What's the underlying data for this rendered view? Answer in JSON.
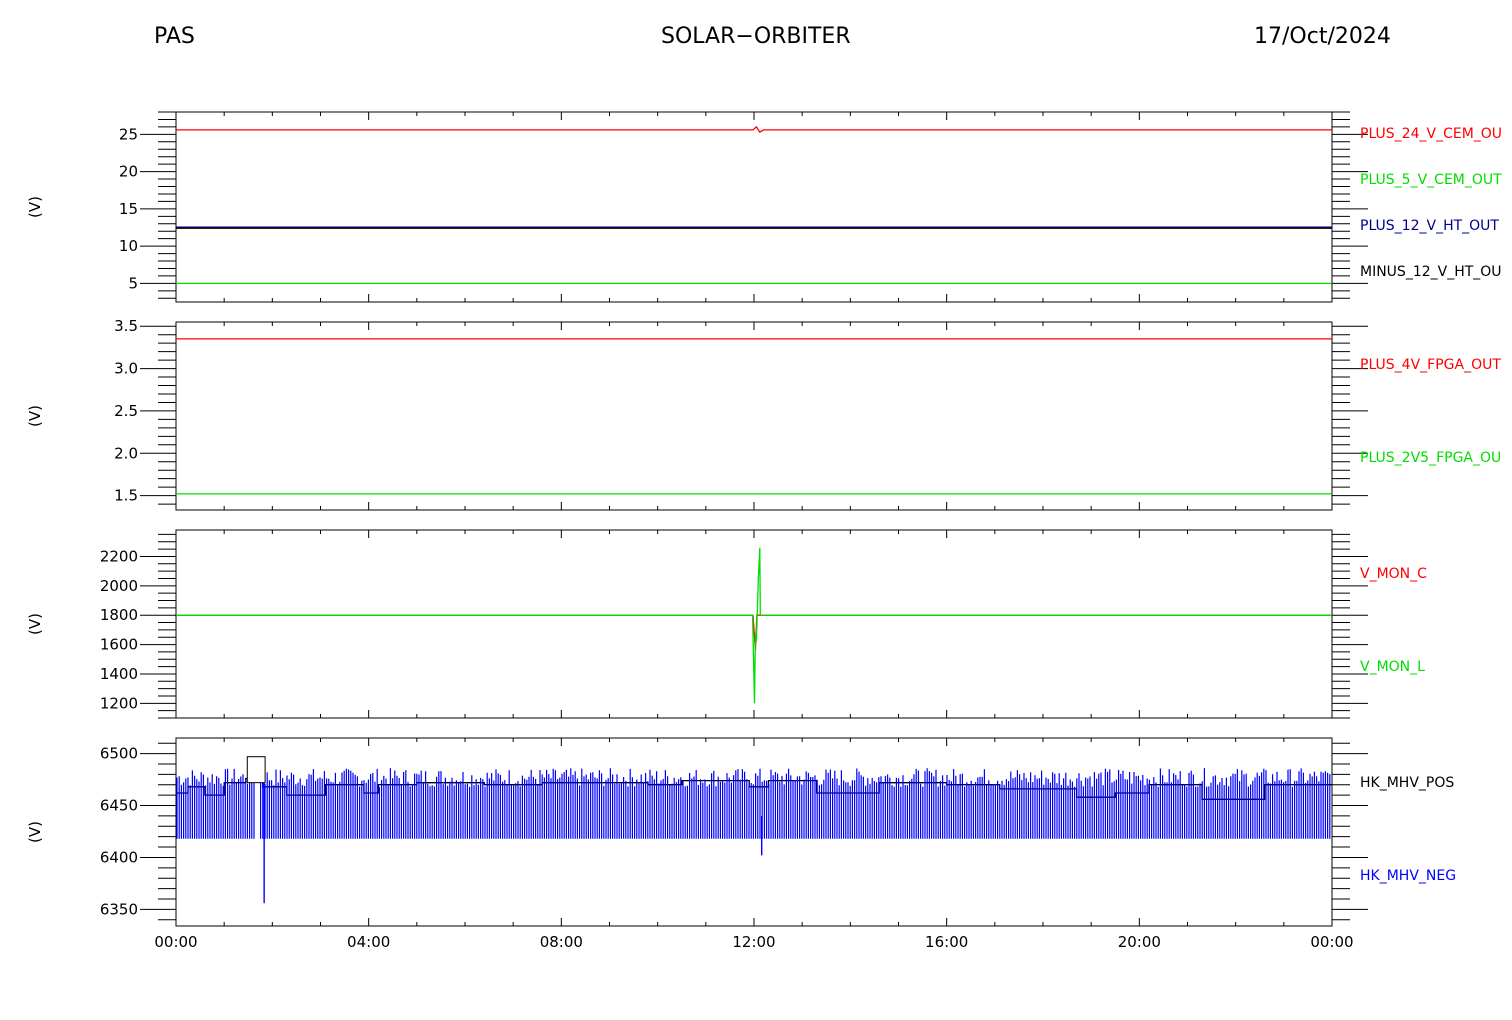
{
  "header": {
    "left": "PAS",
    "center": "SOLAR−ORBITER",
    "right": "17/Oct/2024"
  },
  "x_axis": {
    "ticks": [
      "00:00",
      "04:00",
      "08:00",
      "12:00",
      "16:00",
      "20:00",
      "00:00"
    ],
    "range_hours": [
      0,
      24
    ]
  },
  "chart_data": [
    {
      "type": "line",
      "ylabel": "(V)",
      "ylim": [
        2.5,
        28
      ],
      "yticks": [
        5,
        10,
        15,
        20,
        25
      ],
      "yminor": 1,
      "series": [
        {
          "name": "PLUS_24_V_CEM_OU",
          "color": "#ff0000",
          "x": [
            0,
            11.98,
            12.05,
            12.12,
            12.2,
            24
          ],
          "values": [
            25.6,
            25.6,
            26.0,
            25.3,
            25.6,
            25.6
          ]
        },
        {
          "name": "PLUS_5_V_CEM_OUT",
          "color": "#00dd00",
          "x": [
            0,
            24
          ],
          "values": [
            5.0,
            5.0
          ]
        },
        {
          "name": "PLUS_12_V_HT_OUT",
          "color": "#00008b",
          "x": [
            0,
            24
          ],
          "values": [
            12.5,
            12.5
          ]
        },
        {
          "name": "MINUS_12_V_HT_OU",
          "color": "#000000",
          "x": [
            0,
            24
          ],
          "values": [
            12.4,
            12.4
          ]
        }
      ]
    },
    {
      "type": "line",
      "ylabel": "(V)",
      "ylim": [
        1.33,
        3.55
      ],
      "yticks": [
        1.5,
        2.0,
        2.5,
        3.0,
        3.5
      ],
      "yminor": 0.1,
      "series": [
        {
          "name": "PLUS_4V_FPGA_OUT",
          "color": "#ff0000",
          "x": [
            0,
            24
          ],
          "values": [
            3.35,
            3.35
          ]
        },
        {
          "name": "PLUS_2V5_FPGA_OU",
          "color": "#00dd00",
          "x": [
            0,
            24
          ],
          "values": [
            1.52,
            1.52
          ]
        }
      ]
    },
    {
      "type": "line",
      "ylabel": "(V)",
      "ylim": [
        1100,
        2380
      ],
      "yticks": [
        1200,
        1400,
        1600,
        1800,
        2000,
        2200
      ],
      "yminor": 50,
      "series": [
        {
          "name": "V_MON_C",
          "color": "#ff0000",
          "x": [
            0,
            11.98,
            12.03,
            12.06,
            24
          ],
          "values": [
            1800,
            1800,
            1560,
            1800,
            1800
          ]
        },
        {
          "name": "V_MON_L",
          "color": "#00dd00",
          "x": [
            0,
            11.97,
            12.01,
            12.03,
            12.05,
            12.09,
            12.12,
            12.13,
            12.17,
            24
          ],
          "values": [
            1800,
            1800,
            1200,
            1680,
            1620,
            2040,
            2260,
            1800,
            1800,
            1800
          ]
        }
      ]
    },
    {
      "type": "line",
      "ylabel": "(V)",
      "ylim": [
        6334,
        6515
      ],
      "yticks": [
        6350,
        6400,
        6450,
        6500
      ],
      "yminor": 10,
      "series": [
        {
          "name": "HK_MHV_POS",
          "color": "#000000",
          "x": [
            0,
            0.25,
            0.25,
            0.6,
            0.6,
            1.0,
            1.0,
            1.45,
            1.45,
            1.8,
            1.8,
            2.3,
            2.3,
            3.1,
            3.1,
            3.9,
            3.9,
            4.2,
            4.2,
            5.0,
            5.0,
            6.4,
            6.4,
            7.6,
            7.6,
            9.8,
            9.8,
            10.5,
            10.5,
            11.9,
            11.9,
            12.3,
            12.3,
            13.3,
            13.3,
            14.6,
            14.6,
            16.0,
            16.0,
            17.1,
            17.1,
            18.7,
            18.7,
            19.5,
            19.5,
            20.2,
            20.2,
            21.3,
            21.3,
            22.6,
            22.6,
            24
          ],
          "values": [
            6462,
            6462,
            6468,
            6468,
            6460,
            6460,
            6472,
            6472,
            6476,
            6476,
            6468,
            6468,
            6460,
            6460,
            6470,
            6470,
            6462,
            6462,
            6470,
            6470,
            6472,
            6472,
            6470,
            6470,
            6472,
            6472,
            6470,
            6470,
            6474,
            6474,
            6468,
            6468,
            6474,
            6474,
            6462,
            6462,
            6472,
            6472,
            6470,
            6470,
            6466,
            6466,
            6458,
            6458,
            6462,
            6462,
            6470,
            6470,
            6456,
            6456,
            6470,
            6470
          ]
        },
        {
          "name": "HK_MHV_NEG",
          "color": "#0000ff",
          "x": [
            0,
            24
          ],
          "values": [
            6418,
            6418
          ]
        }
      ]
    }
  ]
}
